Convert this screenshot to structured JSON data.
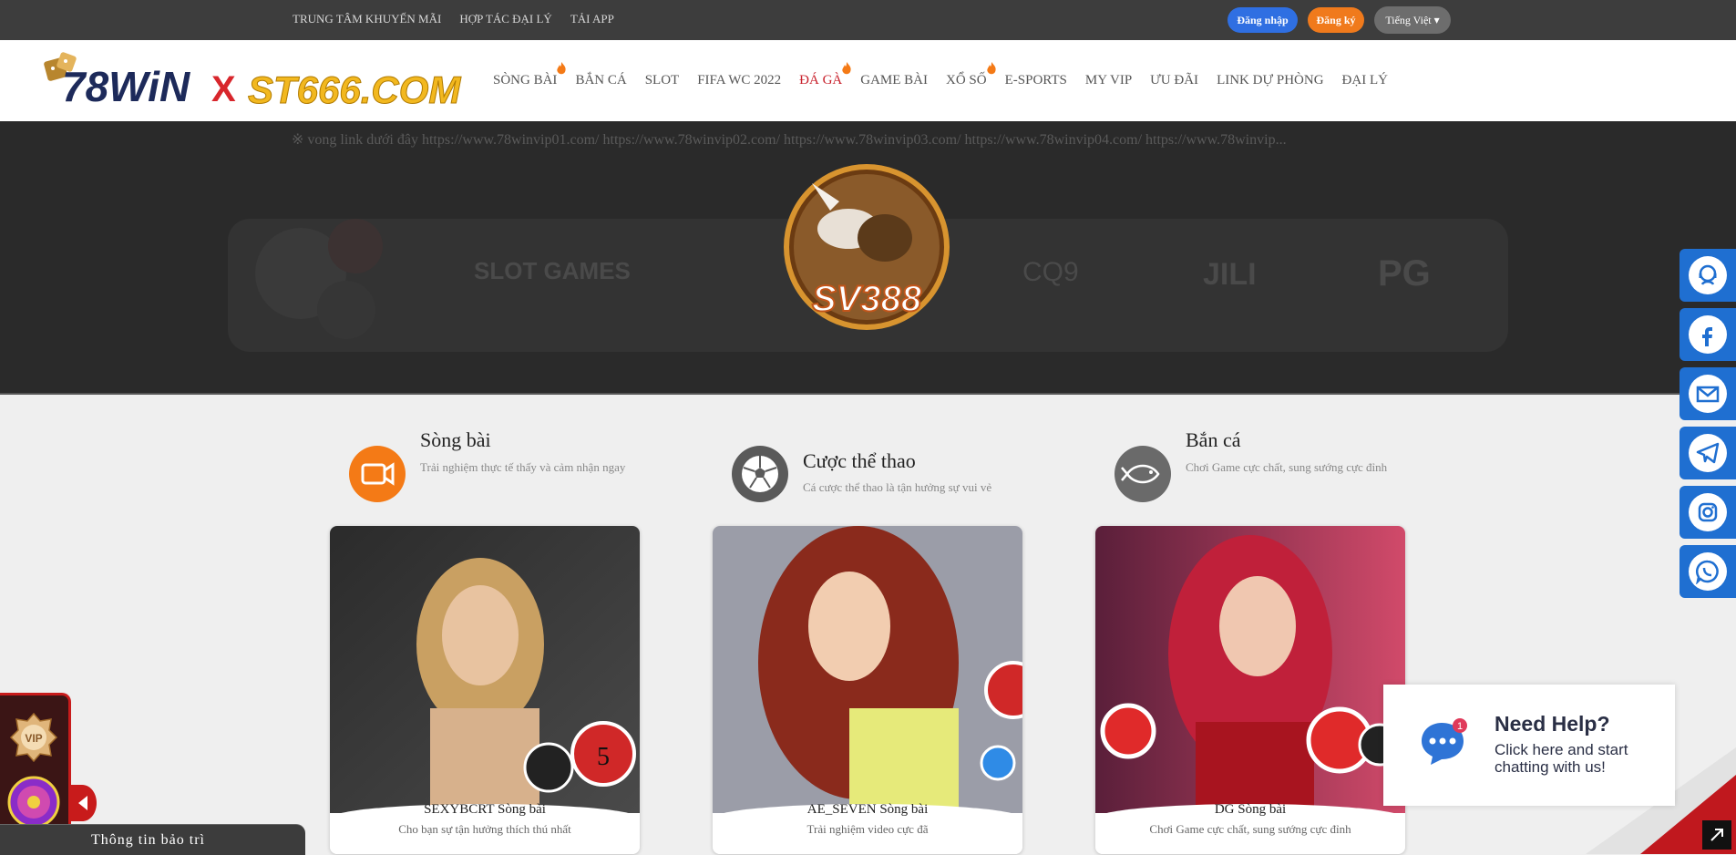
{
  "topbar": {
    "links": [
      "TRUNG TÂM KHUYẾN MÃI",
      "HỢP TÁC ĐẠI LÝ",
      "TẢI APP"
    ],
    "login_label": "Đăng nhập",
    "register_label": "Đăng ký",
    "language_label": "Tiếng Việt ▾"
  },
  "logo": {
    "part1": "78WiN",
    "x": "X",
    "part2": "ST666.COM"
  },
  "nav": {
    "items": [
      "SÒNG BÀI",
      "BẮN CÁ",
      "SLOT",
      "FIFA WC 2022",
      "ĐÁ GÀ",
      "GAME BÀI",
      "XỔ SỐ",
      "E-SPORTS",
      "MY VIP",
      "ƯU ĐÃI",
      "LINK DỰ PHÒNG",
      "ĐẠI LÝ"
    ]
  },
  "hero": {
    "marquee": "※ vong link dưới đây https://www.78winvip01.com/ https://www.78winvip02.com/ https://www.78winvip03.com/ https://www.78winvip04.com/ https://www.78winvip...",
    "providers": [
      "SLOT GAMES",
      "CQ9",
      "JILI",
      "PG"
    ],
    "sv_logo_text": "SV388"
  },
  "categories": [
    {
      "title": "Sòng bài",
      "desc": "Trải nghiệm thực tế thấy và cảm nhận ngay",
      "color": "#f47a16",
      "icon": "video-camera-icon"
    },
    {
      "title": "Cược thể thao",
      "desc": "Cá cược thể thao là tận hưởng sự vui vẻ",
      "color": "#5a5a5a",
      "icon": "soccer-ball-icon"
    },
    {
      "title": "Bắn cá",
      "desc": "Chơi Game cực chất, sung sướng cực đỉnh",
      "color": "#6a6a6a",
      "icon": "fish-icon"
    }
  ],
  "cards": [
    {
      "name": "SEXYBCRT Sòng bài",
      "desc": "Cho bạn sự tận hưởng thích thú nhất"
    },
    {
      "name": "AE_SEVEN Sòng bài",
      "desc": "Trải nghiệm video cực đã"
    },
    {
      "name": "DG Sòng bài",
      "desc": "Chơi Game cực chất, sung sướng cực đỉnh"
    }
  ],
  "social": [
    "support-agent-icon",
    "facebook-icon",
    "email-icon",
    "telegram-icon",
    "instagram-icon",
    "whatsapp-icon"
  ],
  "help": {
    "title": "Need Help?",
    "text": "Click here and start chatting with us!",
    "badge": "1"
  },
  "vip": {
    "label": "VIP"
  },
  "maintenance": {
    "label": "Thông tin bảo trì"
  }
}
